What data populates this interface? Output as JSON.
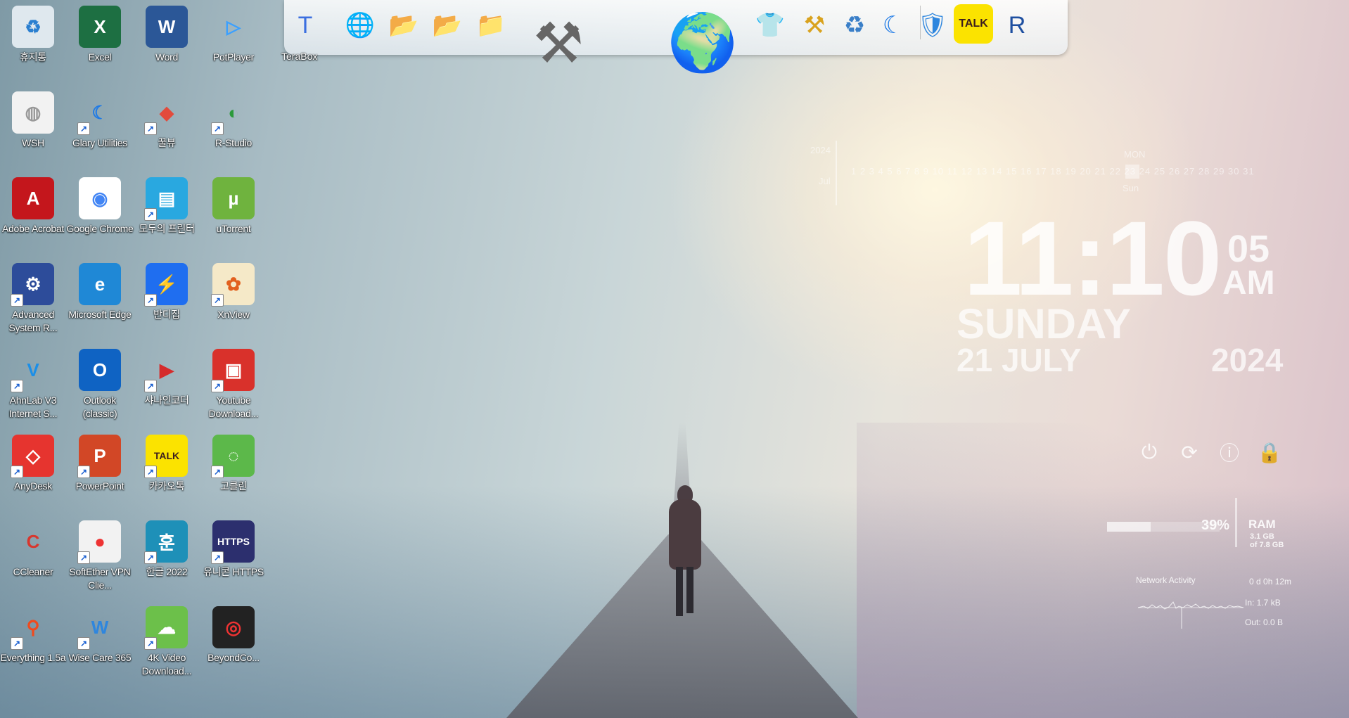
{
  "desktop": {
    "icons": [
      {
        "label": "휴지통",
        "color": "#dfe8ee",
        "glyph": "♻",
        "fg": "#2a7fd0",
        "sc": false
      },
      {
        "label": "Excel",
        "color": "#1d6f42",
        "glyph": "X",
        "fg": "#fff",
        "sc": false
      },
      {
        "label": "Word",
        "color": "#2b5797",
        "glyph": "W",
        "fg": "#fff",
        "sc": false
      },
      {
        "label": "PotPlayer",
        "color": "rgba(0,0,0,0)",
        "glyph": "▷",
        "fg": "#3aa0ff",
        "sc": false
      },
      {
        "label": "WSH",
        "color": "#f2f2f2",
        "glyph": "◍",
        "fg": "#999",
        "sc": false
      },
      {
        "label": "Glary Utilities",
        "color": "rgba(0,0,0,0)",
        "glyph": "☾",
        "fg": "#1e7ae6",
        "sc": true
      },
      {
        "label": "꿀뷰",
        "color": "rgba(0,0,0,0)",
        "glyph": "◆",
        "fg": "#e24b3c",
        "sc": true
      },
      {
        "label": "R-Studio",
        "color": "rgba(0,0,0,0)",
        "glyph": "◐",
        "fg": "#2b9a3a",
        "sc": true
      },
      {
        "label": "Adobe Acrobat",
        "color": "#c4161c",
        "glyph": "A",
        "fg": "#fff",
        "sc": false
      },
      {
        "label": "Google Chrome",
        "color": "#ffffff",
        "glyph": "◉",
        "fg": "#4285f4",
        "sc": false
      },
      {
        "label": "모두의 프린터",
        "color": "#29a8e0",
        "glyph": "▤",
        "fg": "#fff",
        "sc": true
      },
      {
        "label": "uTorrent",
        "color": "#6fb33e",
        "glyph": "µ",
        "fg": "#fff",
        "sc": false
      },
      {
        "label": "Advanced System R...",
        "color": "#2d4c9a",
        "glyph": "⚙",
        "fg": "#fff",
        "sc": true
      },
      {
        "label": "Microsoft Edge",
        "color": "#1f88d6",
        "glyph": "e",
        "fg": "#fff",
        "sc": false
      },
      {
        "label": "반디집",
        "color": "#1f6ef0",
        "glyph": "⚡",
        "fg": "#fff",
        "sc": true
      },
      {
        "label": "XnView",
        "color": "#f5e9c8",
        "glyph": "✿",
        "fg": "#e2601e",
        "sc": true
      },
      {
        "label": "AhnLab V3 Internet S...",
        "color": "rgba(0,0,0,0)",
        "glyph": "V",
        "fg": "#1b8fe8",
        "sc": true
      },
      {
        "label": "Outlook (classic)",
        "color": "#0f63c3",
        "glyph": "O",
        "fg": "#fff",
        "sc": false
      },
      {
        "label": "샤나인코더",
        "color": "rgba(0,0,0,0)",
        "glyph": "▶",
        "fg": "#d52b2b",
        "sc": true
      },
      {
        "label": "Youtube Download...",
        "color": "#d9312b",
        "glyph": "▣",
        "fg": "#fff",
        "sc": true
      },
      {
        "label": "AnyDesk",
        "color": "#e6342f",
        "glyph": "◇",
        "fg": "#fff",
        "sc": true
      },
      {
        "label": "PowerPoint",
        "color": "#d24726",
        "glyph": "P",
        "fg": "#fff",
        "sc": true
      },
      {
        "label": "카카오톡",
        "color": "#fbe300",
        "glyph": "TALK",
        "fg": "#3c1e1e",
        "sc": true
      },
      {
        "label": "고클린",
        "color": "#5cb84a",
        "glyph": "◌",
        "fg": "#fff",
        "sc": true
      },
      {
        "label": "CCleaner",
        "color": "rgba(0,0,0,0)",
        "glyph": "C",
        "fg": "#d8362d",
        "sc": false
      },
      {
        "label": "SoftEther VPN Clie...",
        "color": "#f2f2f2",
        "glyph": "●",
        "fg": "#e33",
        "sc": true
      },
      {
        "label": "한글 2022",
        "color": "#1e90b8",
        "glyph": "훈",
        "fg": "#fff",
        "sc": true
      },
      {
        "label": "유니콘 HTTPS",
        "color": "#2c2f6e",
        "glyph": "HTTPS",
        "fg": "#fff",
        "sc": true
      },
      {
        "label": "Everything 1.5a",
        "color": "rgba(0,0,0,0)",
        "glyph": "⚲",
        "fg": "#f04a1c",
        "sc": true
      },
      {
        "label": "Wise Care 365",
        "color": "rgba(0,0,0,0)",
        "glyph": "W",
        "fg": "#2e86de",
        "sc": true
      },
      {
        "label": "4K Video Download...",
        "color": "#6cc04a",
        "glyph": "☁",
        "fg": "#fff",
        "sc": true
      },
      {
        "label": "BeyondCo...",
        "color": "#222",
        "glyph": "◎",
        "fg": "#e33",
        "sc": false
      }
    ]
  },
  "dock": {
    "terabox_label": "TeraBox",
    "items": [
      {
        "name": "terabox-icon",
        "glyph": "T",
        "color": "#3b6fe0"
      },
      {
        "name": "network-globe-icon",
        "glyph": "🌐",
        "color": "#3a74c2"
      },
      {
        "name": "folder-icon",
        "glyph": "📂",
        "color": "#7a9ad0"
      },
      {
        "name": "folder-green-icon",
        "glyph": "📂",
        "color": "#6aa06a"
      },
      {
        "name": "folder-gray-icon",
        "glyph": "📁",
        "color": "#8a93a8"
      },
      {
        "name": "tools-icon",
        "glyph": "⚒",
        "color": "#666"
      },
      {
        "name": "globe-icon",
        "glyph": "🌍",
        "color": "#2d6fc8"
      },
      {
        "name": "tshirt-icon",
        "glyph": "👕",
        "color": "#111"
      },
      {
        "name": "hammer-wrench-icon",
        "glyph": "⚒",
        "color": "#d9a21e"
      },
      {
        "name": "recycle-bin-icon",
        "glyph": "♻",
        "color": "#3a7fc8"
      },
      {
        "name": "glary-moon-icon",
        "glyph": "☾",
        "color": "#1e7ae6"
      },
      {
        "name": "wise-shield-icon",
        "glyph": "🛡",
        "color": "#2e86de"
      },
      {
        "name": "kakaotalk-icon",
        "glyph": "TALK",
        "color": "#3c1e1e"
      },
      {
        "name": "r-studio-icon",
        "glyph": "R",
        "color": "#1e4fa0"
      }
    ]
  },
  "calendar": {
    "year": "2024",
    "month": "Jul",
    "weekday": "MON",
    "days": "1 2 3 4 5 6 7 8 9 10 11 12 13 14 15 16 17 18 19 20 21 22 23 24 25 26 27 28 29 30 31",
    "selected_label": "Sun"
  },
  "clock": {
    "time": "11:10",
    "seconds": "05",
    "ampm": "AM",
    "day": "SUNDAY",
    "date": "21 JULY",
    "year": "2024"
  },
  "system": {
    "ram_percent_text": "39%",
    "ram_fraction": 0.39,
    "ram_label": "RAM",
    "ram_used": "3.1 GB",
    "ram_total": "of 7.8 GB",
    "network_title": "Network Activity",
    "uptime": "0 d 0h 12m",
    "net_in": "In: 1.7 kB",
    "net_out": "Out: 0.0 B"
  },
  "power": [
    {
      "name": "shutdown-icon",
      "glyph": "⏻"
    },
    {
      "name": "restart-icon",
      "glyph": "⟳"
    },
    {
      "name": "sleep-icon",
      "glyph": "ⓘ"
    },
    {
      "name": "lock-icon",
      "glyph": "🔒"
    }
  ]
}
